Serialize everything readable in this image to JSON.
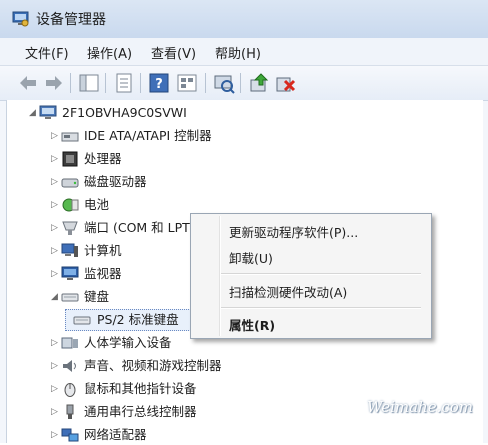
{
  "window": {
    "title": "设备管理器"
  },
  "menu": [
    "文件(F)",
    "操作(A)",
    "查看(V)",
    "帮助(H)"
  ],
  "toolbar": {
    "buttons": [
      "back-arrow-icon",
      "forward-arrow-icon",
      "show-hide-tree-icon",
      "properties-icon",
      "help-icon",
      "view-icon",
      "scan-hardware-icon",
      "update-driver-icon",
      "uninstall-icon"
    ]
  },
  "tree": {
    "root": "2F1OBVHA9C0SVWI",
    "items": [
      {
        "label": "IDE ATA/ATAPI 控制器",
        "icon": "ide-controller-icon"
      },
      {
        "label": "处理器",
        "icon": "processor-icon"
      },
      {
        "label": "磁盘驱动器",
        "icon": "disk-drive-icon"
      },
      {
        "label": "电池",
        "icon": "battery-icon"
      },
      {
        "label": "端口 (COM 和 LPT)",
        "icon": "port-icon"
      },
      {
        "label": "计算机",
        "icon": "computer-icon"
      },
      {
        "label": "监视器",
        "icon": "monitor-icon"
      },
      {
        "label": "键盘",
        "icon": "keyboard-icon",
        "expanded": true
      },
      {
        "label": "PS/2 标准键盘",
        "icon": "keyboard-icon",
        "child": true,
        "selected": true
      },
      {
        "label": "人体学输入设备",
        "icon": "hid-icon"
      },
      {
        "label": "声音、视频和游戏控制器",
        "icon": "sound-icon"
      },
      {
        "label": "鼠标和其他指针设备",
        "icon": "mouse-icon"
      },
      {
        "label": "通用串行总线控制器",
        "icon": "usb-icon"
      },
      {
        "label": "网络适配器",
        "icon": "network-icon"
      }
    ]
  },
  "context_menu": {
    "items": [
      "更新驱动程序软件(P)...",
      "卸载(U)",
      "扫描检测硬件改动(A)",
      "属性(R)"
    ]
  },
  "watermark": "Weimahe.com"
}
